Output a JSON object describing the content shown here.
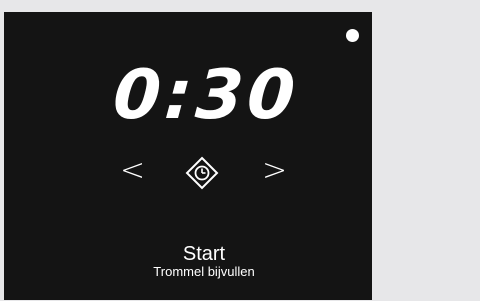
{
  "display": {
    "time": "0:30",
    "indicator": "status-light"
  },
  "controls": {
    "prev_symbol": "<",
    "next_symbol": ">",
    "timer_icon": "timer-diamond-icon"
  },
  "action": {
    "label": "Start",
    "sublabel": "Trommel bijvullen"
  },
  "colors": {
    "panel": "#141414",
    "foreground": "#ffffff",
    "background": "#e7e7e9"
  }
}
